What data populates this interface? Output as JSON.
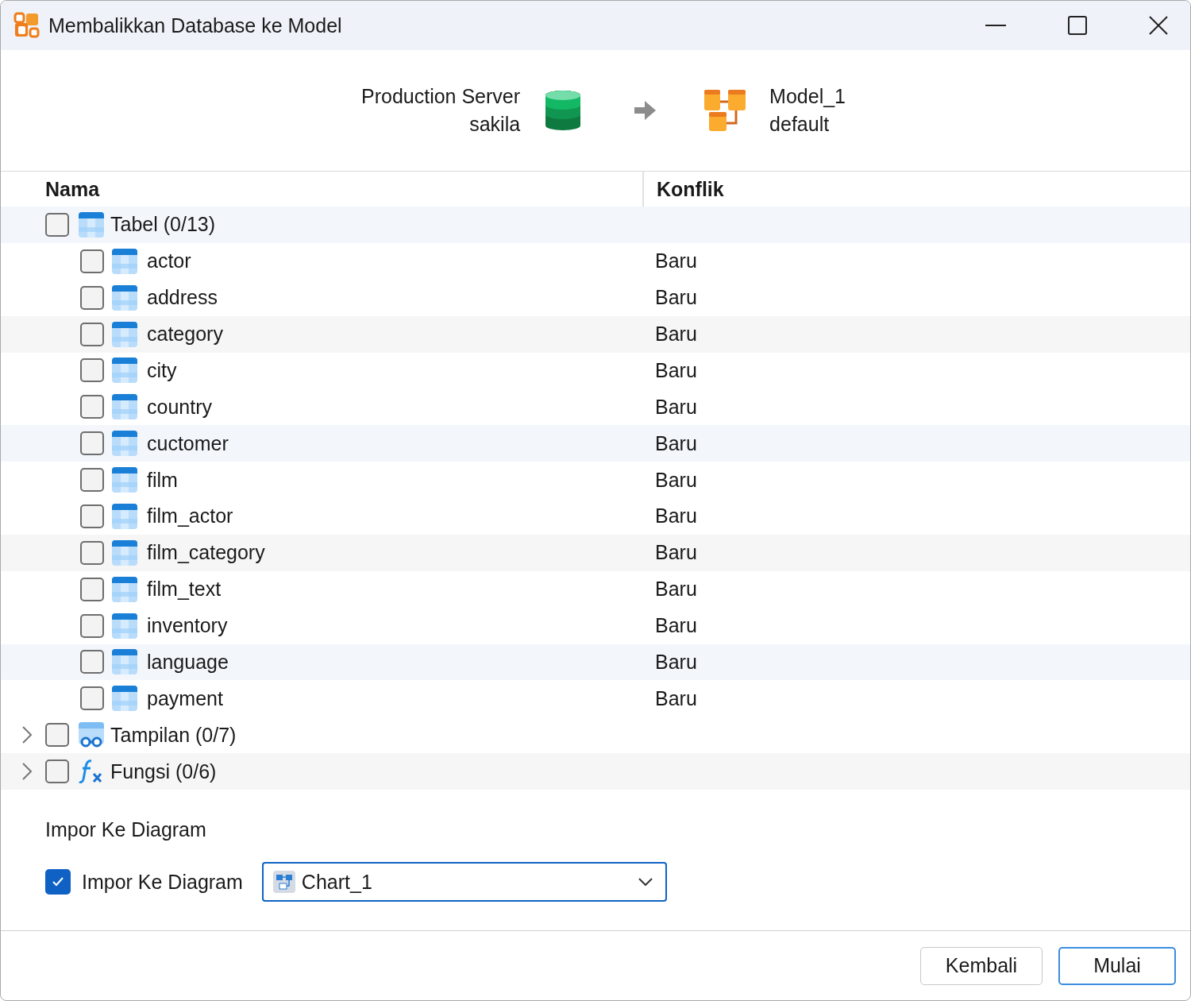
{
  "window": {
    "title": "Membalikkan Database ke Model"
  },
  "source": {
    "server": "Production Server",
    "database": "sakila"
  },
  "target": {
    "model": "Model_1",
    "schema": "default"
  },
  "table": {
    "columns": [
      "Nama",
      "Konflik"
    ],
    "groups": [
      {
        "kind": "table",
        "label": "Tabel (0/13)",
        "checked": false,
        "expanded": true,
        "children": [
          {
            "name": "actor",
            "conflict": "Baru",
            "checked": false
          },
          {
            "name": "address",
            "conflict": "Baru",
            "checked": false
          },
          {
            "name": "category",
            "conflict": "Baru",
            "checked": false
          },
          {
            "name": "city",
            "conflict": "Baru",
            "checked": false
          },
          {
            "name": "country",
            "conflict": "Baru",
            "checked": false
          },
          {
            "name": "cuctomer",
            "conflict": "Baru",
            "checked": false
          },
          {
            "name": "film",
            "conflict": "Baru",
            "checked": false
          },
          {
            "name": "film_actor",
            "conflict": "Baru",
            "checked": false
          },
          {
            "name": "film_category",
            "conflict": "Baru",
            "checked": false
          },
          {
            "name": "film_text",
            "conflict": "Baru",
            "checked": false
          },
          {
            "name": "inventory",
            "conflict": "Baru",
            "checked": false
          },
          {
            "name": "language",
            "conflict": "Baru",
            "checked": false
          },
          {
            "name": "payment",
            "conflict": "Baru",
            "checked": false
          }
        ]
      },
      {
        "kind": "view",
        "label": "Tampilan (0/7)",
        "checked": false,
        "expanded": false
      },
      {
        "kind": "function",
        "label": "Fungsi (0/6)",
        "checked": false,
        "expanded": false
      }
    ]
  },
  "import": {
    "section_title": "Impor Ke Diagram",
    "checkbox_label": "Impor Ke Diagram",
    "checked": true,
    "diagram": "Chart_1"
  },
  "buttons": [
    "Kembali",
    "Mulai"
  ]
}
